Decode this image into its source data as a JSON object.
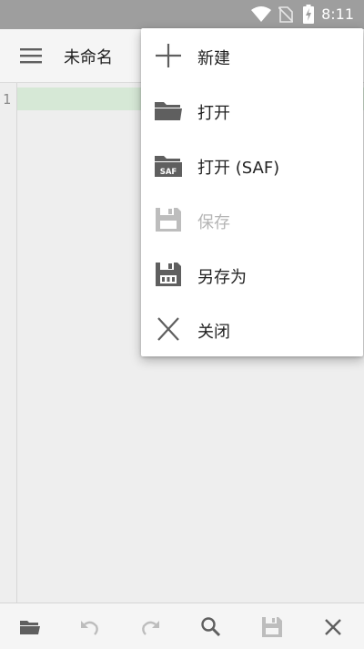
{
  "status_bar": {
    "time": "8:11",
    "icons": [
      "wifi-icon",
      "no-sim-icon",
      "battery-charging-icon"
    ]
  },
  "toolbar": {
    "menu_icon": "hamburger-menu-icon",
    "title": "未命名"
  },
  "editor": {
    "line_numbers": [
      "1"
    ],
    "current_line_highlight": "#d6e8d6"
  },
  "popup_menu": {
    "items": [
      {
        "label": "新建",
        "icon": "plus-icon",
        "enabled": true
      },
      {
        "label": "打开",
        "icon": "folder-icon",
        "enabled": true
      },
      {
        "label": "打开 (SAF)",
        "icon": "folder-saf-icon",
        "enabled": true
      },
      {
        "label": "保存",
        "icon": "save-icon",
        "enabled": false
      },
      {
        "label": "另存为",
        "icon": "save-as-icon",
        "enabled": true
      },
      {
        "label": "关闭",
        "icon": "close-icon",
        "enabled": true
      }
    ]
  },
  "bottom_bar": {
    "buttons": [
      {
        "icon": "folder-open-icon",
        "enabled": true
      },
      {
        "icon": "undo-icon",
        "enabled": false
      },
      {
        "icon": "redo-icon",
        "enabled": false
      },
      {
        "icon": "search-icon",
        "enabled": true
      },
      {
        "icon": "save-icon",
        "enabled": false
      },
      {
        "icon": "close-icon",
        "enabled": true
      }
    ]
  },
  "colors": {
    "status_bar": "#9e9e9e",
    "icon_dark": "#5f5f5f",
    "icon_disabled": "#bdbdbd"
  }
}
